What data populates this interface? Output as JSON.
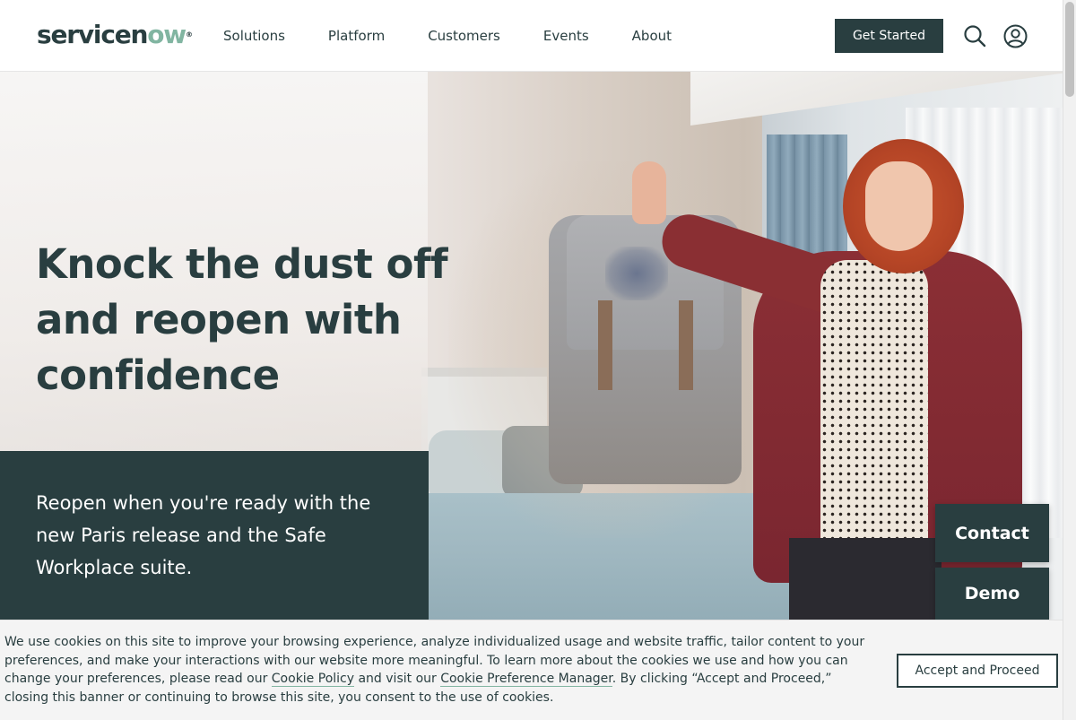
{
  "header": {
    "logo_text_a": "servicen",
    "logo_text_o": "ow",
    "logo_reg": "®",
    "nav": [
      {
        "label": "Solutions"
      },
      {
        "label": "Platform"
      },
      {
        "label": "Customers"
      },
      {
        "label": "Events"
      },
      {
        "label": "About"
      }
    ],
    "cta_label": "Get Started",
    "icons": [
      "search-icon",
      "user-account-icon"
    ]
  },
  "hero": {
    "title": "Knock the dust off and reopen with confidence",
    "subtitle": "Reopen when you're ready with the new Paris release and the Safe Workplace suite.",
    "image": "Woman in a bedroom smiling at a dusty backpack held up in the air"
  },
  "side_buttons": {
    "contact": "Contact",
    "demo": "Demo"
  },
  "cookie_banner": {
    "text_part1": "We use cookies on this site to improve your browsing experience, analyze individualized usage and website traffic, tailor content to your preferences, and make your interactions with our website more meaningful. To learn more about the cookies we use and how you can change your preferences, please read our ",
    "link_policy": "Cookie Policy",
    "text_part2": " and visit our ",
    "link_manager": "Cookie Preference Manager",
    "text_part3": ". By clicking “Accept and Proceed,” closing this banner or continuing to browse this site, you consent to the use of cookies.",
    "accept_label": "Accept and Proceed"
  },
  "colors": {
    "brand_dark": "#293e40",
    "brand_green": "#81b5a1",
    "banner_bg": "#f4f4f4"
  }
}
